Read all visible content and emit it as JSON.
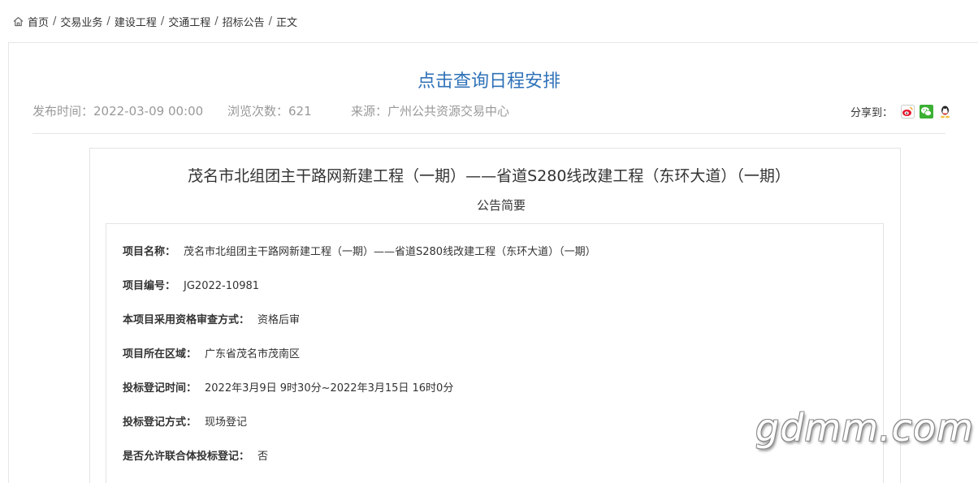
{
  "breadcrumb": {
    "icon": "home-icon",
    "items": [
      "首页",
      "交易业务",
      "建设工程",
      "交通工程",
      "招标公告",
      "正文"
    ],
    "separator": "/"
  },
  "page_title": "点击查询日程安排",
  "meta": {
    "publish_time": "发布时间：2022-03-09 00:00",
    "views": "浏览次数：621",
    "source": "来源：广州公共资源交易中心"
  },
  "share": {
    "label": "分享到：",
    "icons": [
      "weibo-icon",
      "wechat-icon",
      "qq-icon"
    ]
  },
  "notice": {
    "title": "茂名市北组团主干路网新建工程（一期）——省道S280线改建工程（东环大道）（一期）",
    "summary_label": "公告简要",
    "fields": [
      {
        "label": "项目名称：",
        "value": "茂名市北组团主干路网新建工程（一期）——省道S280线改建工程（东环大道）（一期）"
      },
      {
        "label": "项目编号：",
        "value": "JG2022-10981"
      },
      {
        "label": "本项目采用资格审查方式：",
        "value": "资格后审"
      },
      {
        "label": "项目所在区域：",
        "value": "广东省茂名市茂南区"
      },
      {
        "label": "投标登记时间：",
        "value": "2022年3月9日 9时30分~2022年3月15日 16时0分"
      },
      {
        "label": "投标登记方式：",
        "value": "现场登记"
      },
      {
        "label": "是否允许联合体投标登记：",
        "value": "否"
      }
    ]
  },
  "watermark": "gdmm.com",
  "colors": {
    "link_blue": "#2f72b8",
    "meta_gray": "#999999",
    "border": "#e3e3e3"
  }
}
